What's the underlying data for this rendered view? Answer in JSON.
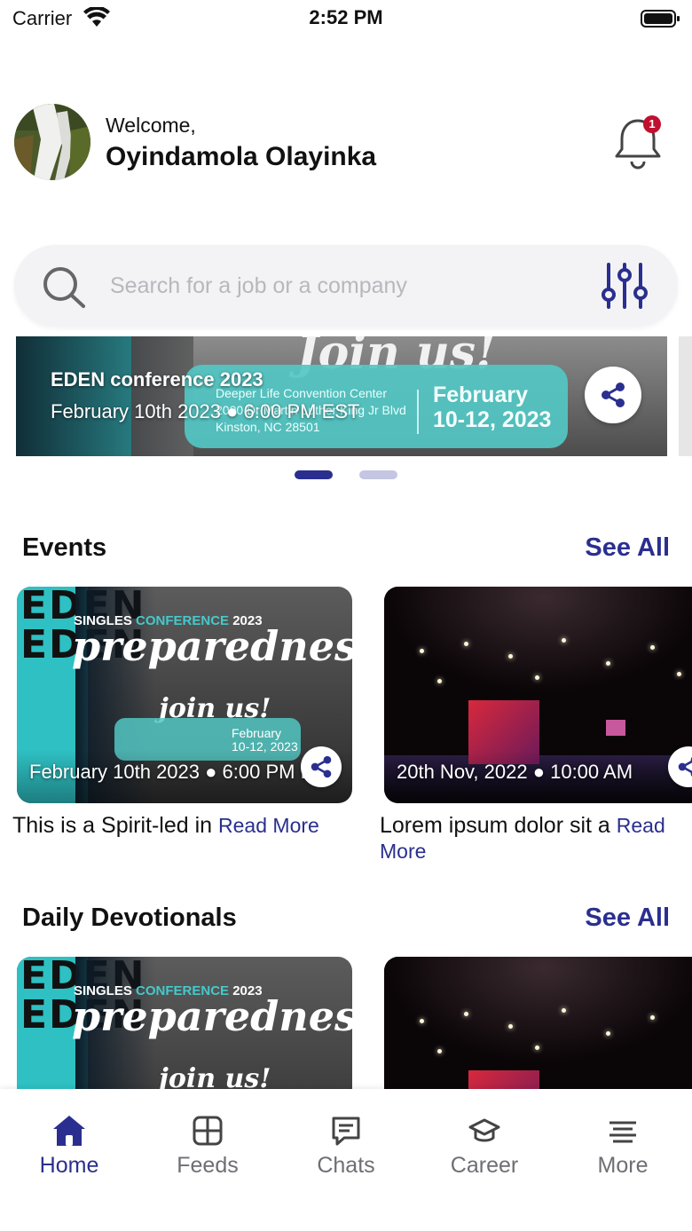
{
  "status_bar": {
    "carrier": "Carrier",
    "time": "2:52 PM"
  },
  "header": {
    "welcome": "Welcome,",
    "user_name": "Oyindamola Olayinka",
    "notification_count": "1"
  },
  "search": {
    "placeholder": "Search for a job or a company"
  },
  "banner": {
    "title": "EDEN conference 2023",
    "datetime": "February 10th 2023 ● 6:00 PM EST",
    "join_text": "Join us!",
    "venue": "Deeper Life Convention Center 2000 Dr Martin Luther King Jr Blvd Kinston, NC 28501",
    "date_range": "February\n10-12, 2023",
    "active_slide": 1,
    "slide_count": 2
  },
  "events": {
    "title": "Events",
    "see_all": "See All",
    "items": [
      {
        "date": "February 10th 2023 ● 6:00 PM EST",
        "description": "This is a Spirit-led in",
        "read_more": "Read More",
        "image": "conference-flyer"
      },
      {
        "date": "20th Nov, 2022 ● 10:00 AM",
        "description": "Lorem ipsum dolor sit a",
        "read_more": "Read More",
        "image": "stage-hall"
      }
    ]
  },
  "devotionals": {
    "title": "Daily Devotionals",
    "see_all": "See All"
  },
  "flyer": {
    "singles_prefix": "SINGLES",
    "singles_middle": "CONFERENCE",
    "singles_year": "2023",
    "preparedness": "preparedness",
    "join": "join us!",
    "pill_date": "February\n10-12, 2023",
    "eden_letters": "EDEN\nEDEN"
  },
  "tabs": [
    {
      "label": "Home",
      "icon": "home-icon",
      "active": true
    },
    {
      "label": "Feeds",
      "icon": "grid-icon",
      "active": false
    },
    {
      "label": "Chats",
      "icon": "chat-icon",
      "active": false
    },
    {
      "label": "Career",
      "icon": "graduation-cap-icon",
      "active": false
    },
    {
      "label": "More",
      "icon": "menu-icon",
      "active": false
    }
  ],
  "colors": {
    "primary": "#2a2f8f",
    "teal": "#35c1c4",
    "badge": "#c0102f"
  }
}
